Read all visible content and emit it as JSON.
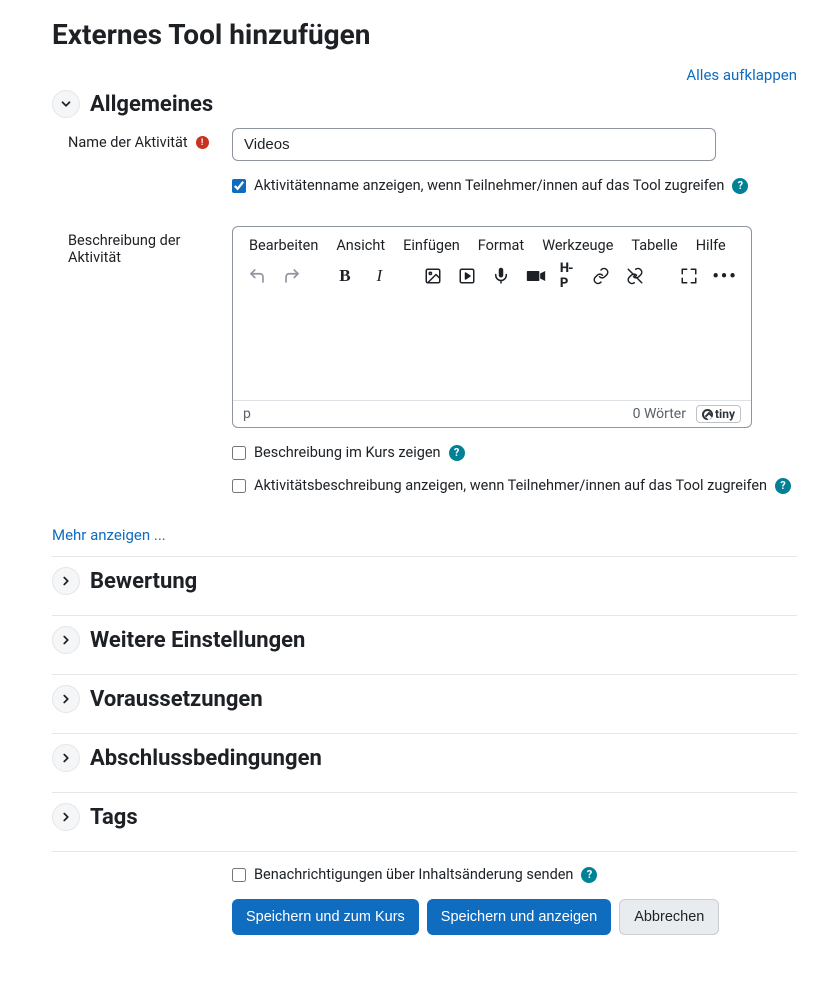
{
  "page": {
    "title": "Externes Tool hinzufügen",
    "expand_all": "Alles aufklappen",
    "show_more": "Mehr anzeigen ..."
  },
  "sections": {
    "general": "Allgemeines",
    "grading": "Bewertung",
    "more_settings": "Weitere Einstellungen",
    "restrictions": "Voraussetzungen",
    "completion": "Abschlussbedingungen",
    "tags": "Tags"
  },
  "labels": {
    "activity_name": "Name der Aktivität",
    "activity_desc": "Beschreibung der Aktivität"
  },
  "inputs": {
    "activity_name_value": "Videos"
  },
  "checkboxes": {
    "show_name": "Aktivitätenname anzeigen, wenn Teilnehmer/innen auf das Tool zugreifen",
    "show_desc_course": "Beschreibung im Kurs zeigen",
    "show_desc_tool": "Aktivitätsbeschreibung anzeigen, wenn Teilnehmer/innen auf das Tool zugreifen",
    "notify": "Benachrichtigungen über Inhaltsänderung senden"
  },
  "editor": {
    "menu": {
      "edit": "Bearbeiten",
      "view": "Ansicht",
      "insert": "Einfügen",
      "format": "Format",
      "tools": "Werkzeuge",
      "table": "Tabelle",
      "help": "Hilfe"
    },
    "path": "p",
    "word_count": "0 Wörter",
    "brand": "tiny"
  },
  "buttons": {
    "save_return": "Speichern und zum Kurs",
    "save_display": "Speichern und anzeigen",
    "cancel": "Abbrechen"
  }
}
